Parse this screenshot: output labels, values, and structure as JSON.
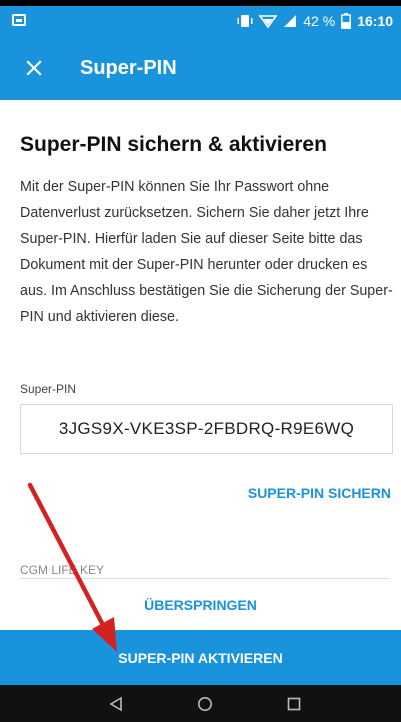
{
  "status_bar": {
    "battery_percent": "42 %",
    "time": "16:10"
  },
  "app_bar": {
    "close_icon": "close-icon",
    "title": "Super-PIN"
  },
  "content": {
    "heading": "Super-PIN sichern & aktivieren",
    "paragraph": "Mit der Super-PIN können Sie Ihr Passwort ohne Datenverlust zurücksetzen. Sichern Sie daher jetzt Ihre Super-PIN. Hierfür laden Sie auf dieser Seite bitte das Dokument mit der Super-PIN herunter oder drucken es aus. Im Anschluss bestätigen Sie die Sicherung der Super-PIN und aktivieren diese.",
    "pin_label": "Super-PIN",
    "pin_value": "3JGS9X-VKE3SP-2FBDRQ-R9E6WQ",
    "save_label": "SUPER-PIN SICHERN",
    "cgm_label": "CGM LIFE KEY"
  },
  "actions": {
    "skip_label": "ÜBERSPRINGEN",
    "activate_label": "SUPER-PIN AKTIVIEREN"
  },
  "nav_bar": {
    "back_icon": "back-triangle-icon",
    "home_icon": "home-circle-icon",
    "recents_icon": "recents-square-icon"
  },
  "colors": {
    "primary": "#1a93dd",
    "arrow": "#d32222"
  }
}
